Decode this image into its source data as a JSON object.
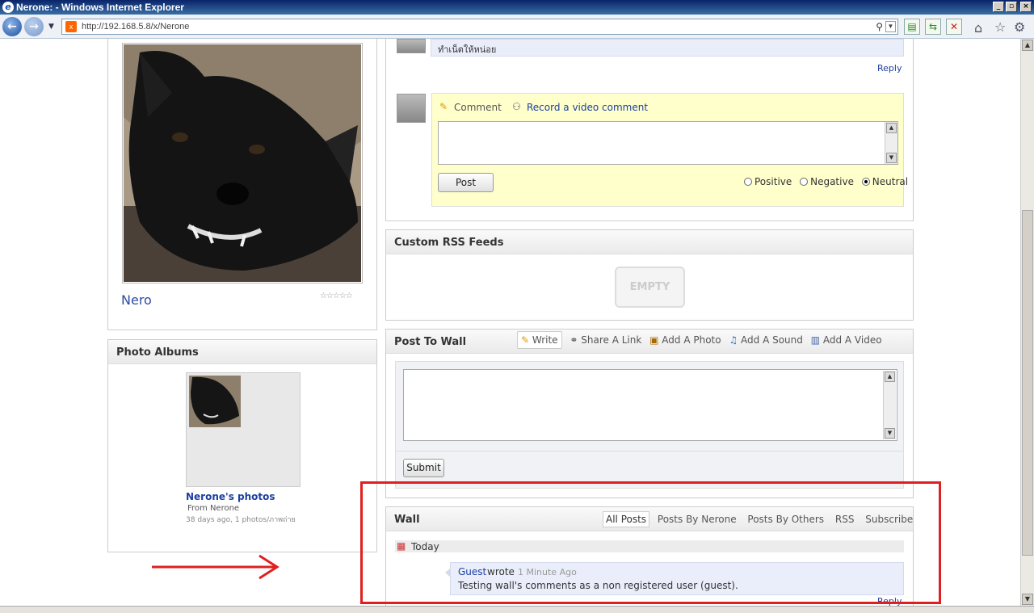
{
  "window": {
    "title": "Nerone: - Windows Internet Explorer"
  },
  "browser": {
    "url": "http://192.168.5.8/x/Nerone"
  },
  "profile": {
    "name": "Nero",
    "rating": "☆☆☆☆☆"
  },
  "photo_albums": {
    "title": "Photo Albums",
    "album_name": "Nerone's photos",
    "from": "From Nerone",
    "meta": "38 days ago, 1 photos/ภาพถ่าย"
  },
  "comments": {
    "previous_text": "ทำเน็ตให้หน่อย",
    "reply_label": "Reply",
    "comment_tab": "Comment",
    "video_tab": "Record a video comment",
    "post_button": "Post",
    "ratings": [
      "Positive",
      "Negative",
      "Neutral"
    ],
    "selected_rating": "Neutral"
  },
  "rss": {
    "title": "Custom RSS Feeds",
    "empty_label": "EMPTY"
  },
  "post_to_wall": {
    "title": "Post To Wall",
    "tabs": [
      "Write",
      "Share A Link",
      "Add A Photo",
      "Add A Sound",
      "Add A Video"
    ],
    "submit_label": "Submit"
  },
  "wall": {
    "title": "Wall",
    "tabs": [
      "All Posts",
      "Posts By Nerone",
      "Posts By Others",
      "RSS",
      "Subscribe"
    ],
    "day_label": "Today",
    "post": {
      "author": "Guest",
      "verb": "wrote",
      "time": "1 Minute Ago",
      "text": "Testing wall's comments as a non registered user (guest).",
      "reply_label": "Reply"
    }
  },
  "colors": {
    "highlight": "#e02020",
    "accent": "#1c3fa0",
    "comment_bg": "#ffffcc"
  }
}
